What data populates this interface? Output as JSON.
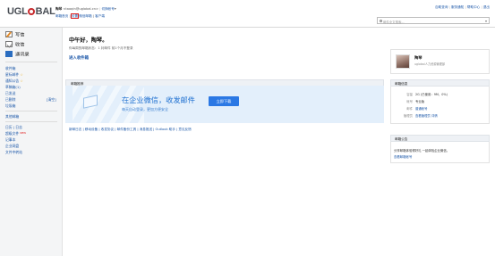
{
  "header": {
    "logo_pre": "UGL",
    "logo_post": "BAL",
    "user_name": "陶琴",
    "user_email": "<taoqin@uglobal.cn>",
    "switch_account": "切换帐号",
    "nav": {
      "home": "邮箱首页",
      "settings": "设置",
      "separator1": "|",
      "mobile_mail": "微信邮箱",
      "separator2": "|",
      "client": "客户端"
    },
    "top_links": {
      "self_service": "自助查询",
      "sep1": "|",
      "service_hotline": "服务通知",
      "sep2": "|",
      "help_center": "帮助中心",
      "sep3": "|",
      "logout": "退出"
    },
    "search_placeholder": "邮件全文搜索..."
  },
  "sidebar": {
    "compose": "写信",
    "inbox": "收信",
    "contacts": "通讯录",
    "items": [
      {
        "label": "收件箱",
        "count": ""
      },
      {
        "label": "星标邮件",
        "count": "☆"
      },
      {
        "label": "通知公告",
        "count": "☆"
      },
      {
        "label": "草稿箱",
        "count": "(1)"
      },
      {
        "label": "已发送",
        "count": ""
      },
      {
        "label": "已删除",
        "count": ""
      },
      {
        "label": "垃圾箱",
        "count": ""
      }
    ],
    "clear_label": "[清空]",
    "other_mailboxes": "其他邮箱",
    "tools": [
      {
        "label": "日历 | 日志"
      },
      {
        "label": "超级文件",
        "badge": "NEW"
      },
      {
        "label": "记事本"
      },
      {
        "label": "企业网盘"
      },
      {
        "label": "文件中转站"
      }
    ]
  },
  "main": {
    "greeting": "中午好，陶琴。",
    "greeting_sub": "你每周的邮箱状态：1 封邮件 前1个月不登录",
    "inbox_link": "进入收件箱",
    "promo_section_title": "邮箱推荐",
    "promo_headline": "在企业微信，收发邮件",
    "promo_sub": "每天自动登录，更加方便安全",
    "promo_button": "立即下载",
    "bottom_links": "新邮日志 | 移动设备 | 收发协议 | 邮件备份工具 | 消息推送 | Outlook 助手 | 意见反馈"
  },
  "profile": {
    "name": "陶琴",
    "org": "uglobal人力资源管理部"
  },
  "mail_info": {
    "title": "邮箱信息",
    "rows": [
      {
        "key": "容量",
        "value": "2G (已使用：9M，0%)"
      },
      {
        "key": "帐号",
        "value": "专业版"
      },
      {
        "key": "邮件",
        "value": "普通帐号"
      },
      {
        "key": "管理员",
        "value": "查看管理员 详情"
      }
    ]
  },
  "notice": {
    "title": "邮箱公告",
    "line1": "分享邮箱体验得好礼 一起体验企业微信。",
    "line2": "查看邮箱帐号"
  }
}
